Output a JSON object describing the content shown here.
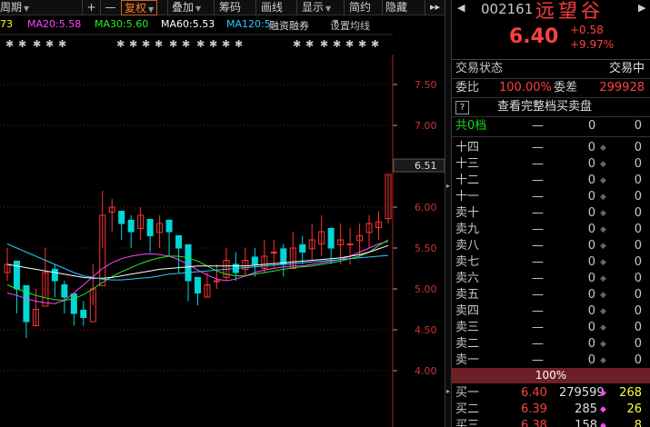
{
  "toolbar": {
    "items": [
      "周期",
      "+",
      "—",
      "复权",
      "叠加",
      "筹码",
      "画线",
      "显示",
      "简约",
      "隐藏"
    ],
    "more_icon": "double-chevron-right"
  },
  "ma_legend": {
    "ma10_tail": "73",
    "ma20": "MA20:5.58",
    "ma30": "MA30:5.60",
    "ma60": "MA60:5.53",
    "ma120": "MA120:5.",
    "margin": "融资融券",
    "setting": "设置均线",
    "colors": {
      "ma10": "#ffff00",
      "ma20": "#ff44ff",
      "ma30": "#22ee22",
      "ma60": "#ffffff",
      "ma120": "#2ec8ff"
    }
  },
  "chart": {
    "y_ticks": [
      "7.50",
      "7.00",
      "6.51",
      "6.00",
      "5.50",
      "5.00",
      "4.50",
      "4.00"
    ],
    "y_values": [
      7.5,
      7.0,
      6.51,
      6.0,
      5.5,
      5.0,
      4.5,
      4.0
    ],
    "current_price_label": "6.51",
    "colors": {
      "up": "#ff3333",
      "down": "#00d6d6",
      "grid": "#7a1010"
    }
  },
  "chart_data": {
    "type": "candlestick",
    "ylim": [
      3.9,
      7.8
    ],
    "series": [
      {
        "name": "MA20",
        "color": "#ff44ff",
        "values": [
          4.95,
          4.92,
          4.88,
          4.85,
          4.83,
          4.82,
          4.86,
          4.95,
          5.05,
          5.15,
          5.25,
          5.32,
          5.37,
          5.4,
          5.42,
          5.43,
          5.42,
          5.4,
          5.36,
          5.3,
          5.23,
          5.17,
          5.12,
          5.1,
          5.12,
          5.16,
          5.2,
          5.23,
          5.25,
          5.27,
          5.28,
          5.28,
          5.3,
          5.32,
          5.34,
          5.36,
          5.4,
          5.45,
          5.5,
          5.55,
          5.58
        ]
      },
      {
        "name": "MA30",
        "color": "#22ee22",
        "values": [
          5.05,
          5.0,
          4.96,
          4.92,
          4.89,
          4.87,
          4.86,
          4.88,
          4.93,
          5.0,
          5.08,
          5.15,
          5.21,
          5.26,
          5.31,
          5.35,
          5.38,
          5.4,
          5.4,
          5.38,
          5.34,
          5.28,
          5.22,
          5.18,
          5.16,
          5.16,
          5.18,
          5.2,
          5.22,
          5.24,
          5.26,
          5.27,
          5.28,
          5.3,
          5.32,
          5.34,
          5.37,
          5.4,
          5.45,
          5.53,
          5.6
        ]
      },
      {
        "name": "MA60",
        "color": "#ffffff",
        "values": [
          5.3,
          5.28,
          5.26,
          5.24,
          5.22,
          5.2,
          5.18,
          5.16,
          5.14,
          5.13,
          5.13,
          5.14,
          5.16,
          5.18,
          5.2,
          5.22,
          5.24,
          5.25,
          5.26,
          5.27,
          5.28,
          5.28,
          5.28,
          5.28,
          5.28,
          5.28,
          5.29,
          5.3,
          5.31,
          5.32,
          5.33,
          5.34,
          5.35,
          5.36,
          5.37,
          5.38,
          5.4,
          5.42,
          5.45,
          5.49,
          5.53
        ]
      },
      {
        "name": "MA120",
        "color": "#2ec8ff",
        "values": [
          5.55,
          5.5,
          5.45,
          5.4,
          5.35,
          5.3,
          5.25,
          5.2,
          5.16,
          5.14,
          5.12,
          5.11,
          5.11,
          5.12,
          5.13,
          5.14,
          5.16,
          5.18,
          5.19,
          5.2,
          5.21,
          5.22,
          5.23,
          5.24,
          5.25,
          5.26,
          5.27,
          5.28,
          5.29,
          5.3,
          5.31,
          5.32,
          5.33,
          5.34,
          5.35,
          5.36,
          5.37,
          5.38,
          5.39,
          5.4,
          5.41
        ]
      }
    ],
    "candles_close": [
      5.3,
      5.0,
      4.6,
      4.75,
      5.2,
      5.1,
      4.9,
      4.7,
      4.65,
      5.0,
      5.9,
      6.0,
      5.8,
      5.7,
      5.9,
      5.65,
      5.8,
      5.7,
      5.5,
      5.1,
      4.95,
      5.05,
      5.1,
      5.35,
      5.2,
      5.35,
      5.3,
      5.4,
      5.45,
      5.3,
      5.5,
      5.45,
      5.6,
      5.7,
      5.5,
      5.6,
      5.55,
      5.65,
      5.8,
      5.82,
      6.4
    ],
    "candles_high": [
      5.5,
      5.2,
      4.9,
      5.0,
      5.5,
      5.3,
      5.1,
      4.9,
      4.85,
      5.3,
      6.2,
      6.1,
      5.95,
      5.9,
      6.0,
      5.85,
      5.9,
      5.85,
      5.6,
      5.35,
      5.1,
      5.2,
      5.3,
      5.5,
      5.45,
      5.5,
      5.5,
      5.6,
      5.6,
      5.55,
      5.7,
      5.65,
      5.8,
      5.9,
      5.75,
      5.8,
      5.75,
      5.8,
      5.9,
      5.95,
      6.4
    ],
    "candles_low": [
      5.1,
      4.7,
      4.4,
      4.55,
      4.9,
      4.9,
      4.7,
      4.55,
      4.55,
      4.8,
      5.5,
      5.7,
      5.6,
      5.5,
      5.6,
      5.45,
      5.5,
      5.4,
      5.2,
      4.85,
      4.8,
      4.9,
      5.0,
      5.1,
      5.1,
      5.15,
      5.15,
      5.2,
      5.25,
      5.15,
      5.25,
      5.3,
      5.35,
      5.4,
      5.3,
      5.3,
      5.3,
      5.4,
      5.5,
      5.6,
      5.8
    ]
  },
  "quote": {
    "code": "002161",
    "name": "远望谷",
    "price": "6.40",
    "change": "+0.58",
    "change_pct": "+9.97%",
    "status_label": "交易状态",
    "status_value": "交易中",
    "ratio_label": "委比",
    "ratio_value": "100.00%",
    "diff_label": "委差",
    "diff_value": "299928",
    "full_book_icon": "?",
    "full_book_label": "查看完整档买卖盘",
    "gong_label": "共0档",
    "gong_price": "—",
    "gong_vol": "0",
    "gong_order": "0"
  },
  "asks": [
    {
      "label": "十四",
      "price": "—",
      "vol": "0",
      "order": "0"
    },
    {
      "label": "十三",
      "price": "—",
      "vol": "0",
      "order": "0"
    },
    {
      "label": "十二",
      "price": "—",
      "vol": "0",
      "order": "0"
    },
    {
      "label": "十一",
      "price": "—",
      "vol": "0",
      "order": "0"
    },
    {
      "label": "卖十",
      "price": "—",
      "vol": "0",
      "order": "0"
    },
    {
      "label": "卖九",
      "price": "—",
      "vol": "0",
      "order": "0"
    },
    {
      "label": "卖八",
      "price": "—",
      "vol": "0",
      "order": "0"
    },
    {
      "label": "卖七",
      "price": "—",
      "vol": "0",
      "order": "0"
    },
    {
      "label": "卖六",
      "price": "—",
      "vol": "0",
      "order": "0"
    },
    {
      "label": "卖五",
      "price": "—",
      "vol": "0",
      "order": "0"
    },
    {
      "label": "卖四",
      "price": "—",
      "vol": "0",
      "order": "0"
    },
    {
      "label": "卖三",
      "price": "—",
      "vol": "0",
      "order": "0"
    },
    {
      "label": "卖二",
      "price": "—",
      "vol": "0",
      "order": "0"
    },
    {
      "label": "卖一",
      "price": "—",
      "vol": "0",
      "order": "0"
    }
  ],
  "pct_bar": "100%",
  "bids": [
    {
      "label": "买一",
      "price": "6.40",
      "vol": "279599",
      "order": "268"
    },
    {
      "label": "买二",
      "price": "6.39",
      "vol": "285",
      "order": "26"
    },
    {
      "label": "买三",
      "price": "6.38",
      "vol": "158",
      "order": "8"
    }
  ]
}
